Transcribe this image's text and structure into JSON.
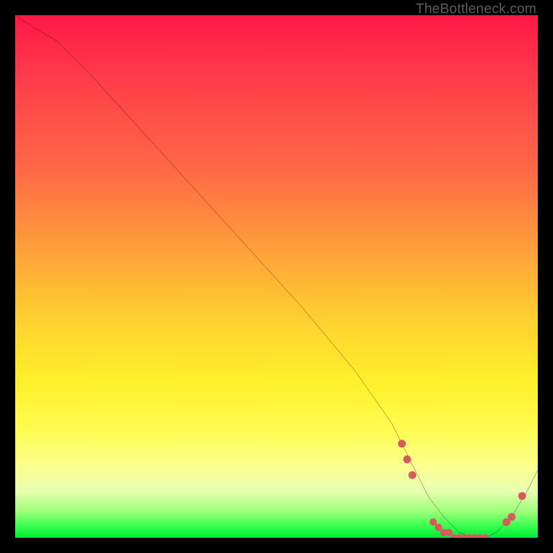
{
  "attribution": "TheBottleneck.com",
  "colors": {
    "bg": "#000000",
    "gradient_top": "#ff1846",
    "gradient_bottom": "#00e838",
    "curve": "#000000",
    "markers": "#d85a5a"
  },
  "chart_data": {
    "type": "line",
    "title": "",
    "xlabel": "",
    "ylabel": "",
    "xlim": [
      0,
      100
    ],
    "ylim": [
      0,
      100
    ],
    "x": [
      0,
      3,
      8,
      15,
      25,
      35,
      45,
      55,
      65,
      72,
      76,
      79,
      82,
      85,
      88,
      90,
      92,
      95,
      98,
      100
    ],
    "values": [
      100,
      98,
      95,
      88,
      77,
      66,
      55,
      44,
      32,
      22,
      14,
      8,
      4,
      1,
      0,
      0,
      1,
      4,
      9,
      13
    ],
    "markers_x": [
      74,
      75,
      76,
      80,
      81,
      82,
      83,
      84,
      85,
      86,
      87,
      88,
      89,
      90,
      94,
      95,
      97
    ],
    "markers_y": [
      18,
      15,
      12,
      3,
      2,
      1,
      1,
      0,
      0,
      0,
      0,
      0,
      0,
      0,
      3,
      4,
      8
    ]
  }
}
